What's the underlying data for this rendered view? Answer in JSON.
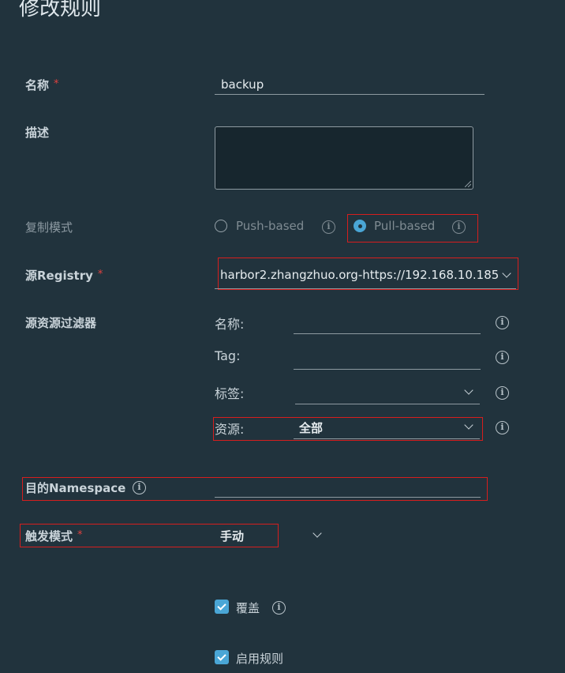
{
  "title": "修改规则",
  "name": {
    "label": "名称",
    "required": "*",
    "value": "backup"
  },
  "description": {
    "label": "描述",
    "value": ""
  },
  "replication_mode": {
    "label": "复制模式",
    "options": [
      {
        "label": "Push-based",
        "selected": false
      },
      {
        "label": "Pull-based",
        "selected": true
      }
    ]
  },
  "source_registry": {
    "label": "源Registry",
    "required": "*",
    "value": "harbor2.zhangzhuo.org-https://192.168.10.185"
  },
  "source_filter": {
    "label": "源资源过滤器",
    "name_label": "名称:",
    "name_value": "",
    "tag_label": "Tag:",
    "tag_value": "",
    "labels_label": "标签:",
    "labels_value": "",
    "resource_label": "资源:",
    "resource_value": "全部"
  },
  "dest_namespace": {
    "label": "目的Namespace",
    "value": ""
  },
  "trigger_mode": {
    "label": "触发模式",
    "required": "*",
    "value": "手动"
  },
  "override": {
    "label": "覆盖",
    "checked": true
  },
  "enable_rule": {
    "label": "启用规则",
    "checked": true
  },
  "info_glyph": "i",
  "colors": {
    "background": "#21333d",
    "accent": "#4aa6d6",
    "highlight": "#d61e1e",
    "required": "#e0413f"
  }
}
